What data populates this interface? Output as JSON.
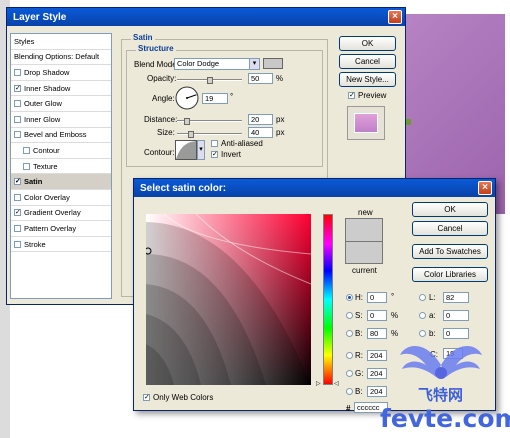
{
  "layer_style": {
    "title": "Layer Style",
    "list": [
      {
        "label": "Styles",
        "checkbox": false,
        "checked": false,
        "indent": false,
        "selected": false
      },
      {
        "label": "Blending Options: Default",
        "checkbox": false,
        "checked": false,
        "indent": false,
        "selected": false
      },
      {
        "label": "Drop Shadow",
        "checkbox": true,
        "checked": false,
        "indent": false,
        "selected": false
      },
      {
        "label": "Inner Shadow",
        "checkbox": true,
        "checked": true,
        "indent": false,
        "selected": false
      },
      {
        "label": "Outer Glow",
        "checkbox": true,
        "checked": false,
        "indent": false,
        "selected": false
      },
      {
        "label": "Inner Glow",
        "checkbox": true,
        "checked": false,
        "indent": false,
        "selected": false
      },
      {
        "label": "Bevel and Emboss",
        "checkbox": true,
        "checked": false,
        "indent": false,
        "selected": false
      },
      {
        "label": "Contour",
        "checkbox": true,
        "checked": false,
        "indent": true,
        "selected": false
      },
      {
        "label": "Texture",
        "checkbox": true,
        "checked": false,
        "indent": true,
        "selected": false
      },
      {
        "label": "Satin",
        "checkbox": true,
        "checked": true,
        "indent": false,
        "selected": true
      },
      {
        "label": "Color Overlay",
        "checkbox": true,
        "checked": false,
        "indent": false,
        "selected": false
      },
      {
        "label": "Gradient Overlay",
        "checkbox": true,
        "checked": true,
        "indent": false,
        "selected": false
      },
      {
        "label": "Pattern Overlay",
        "checkbox": true,
        "checked": false,
        "indent": false,
        "selected": false
      },
      {
        "label": "Stroke",
        "checkbox": true,
        "checked": false,
        "indent": false,
        "selected": false
      }
    ],
    "satin_title": "Satin",
    "structure_title": "Structure",
    "blend_mode_label": "Blend Mode:",
    "blend_mode_value": "Color Dodge",
    "opacity_label": "Opacity:",
    "opacity_value": "50",
    "opacity_unit": "%",
    "angle_label": "Angle:",
    "angle_value": "19",
    "angle_unit": "°",
    "distance_label": "Distance:",
    "distance_value": "20",
    "distance_unit": "px",
    "size_label": "Size:",
    "size_value": "40",
    "size_unit": "px",
    "contour_label": "Contour:",
    "anti_aliased_label": "Anti-aliased",
    "invert_label": "Invert",
    "ok_label": "OK",
    "cancel_label": "Cancel",
    "new_style_label": "New Style...",
    "preview_label": "Preview",
    "satin_color": "#c8c8c8"
  },
  "color_picker": {
    "title": "Select satin color:",
    "ok_label": "OK",
    "cancel_label": "Cancel",
    "add_swatches_label": "Add To Swatches",
    "color_libraries_label": "Color Libraries",
    "new_label": "new",
    "current_label": "current",
    "new_color": "#cccccc",
    "current_color": "#cccccc",
    "h_label": "H:",
    "h_value": "0",
    "h_unit": "°",
    "s_label": "S:",
    "s_value": "0",
    "s_unit": "%",
    "b_label": "B:",
    "b_value": "80",
    "b_unit": "%",
    "r_label": "R:",
    "r_value": "204",
    "g_label": "G:",
    "g_value": "204",
    "b2_label": "B:",
    "b2_value": "204",
    "l_label": "L:",
    "l_value": "82",
    "a_label": "a:",
    "a_value": "0",
    "lab_b_label": "b:",
    "lab_b_value": "0",
    "c_label": "C:",
    "c_value": "19",
    "hash_label": "#",
    "hex_value": "cccccc",
    "only_web_colors_label": "Only Web Colors"
  },
  "watermark": {
    "site": "fevte.com",
    "brand": "飞特网"
  }
}
